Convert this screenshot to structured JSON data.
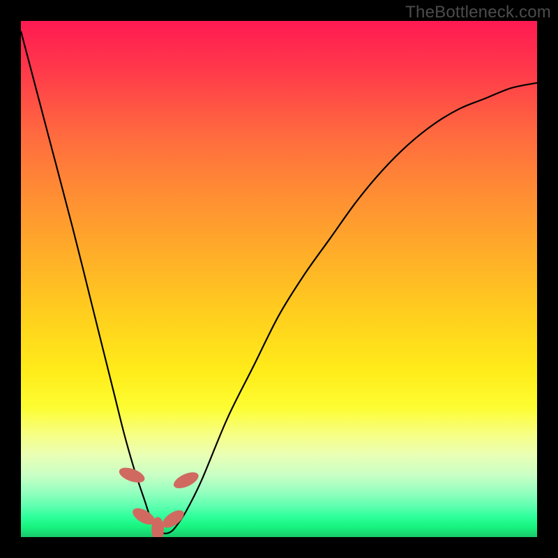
{
  "watermark": "TheBottleneck.com",
  "chart_data": {
    "type": "line",
    "title": "",
    "xlabel": "",
    "ylabel": "",
    "xlim": [
      0,
      100
    ],
    "ylim": [
      0,
      100
    ],
    "series": [
      {
        "name": "curve",
        "x": [
          0,
          5,
          10,
          15,
          18,
          20,
          22,
          24,
          25,
          26,
          27,
          28,
          29,
          30,
          32,
          35,
          40,
          45,
          50,
          55,
          60,
          65,
          70,
          75,
          80,
          85,
          90,
          95,
          100
        ],
        "values": [
          98,
          79,
          60,
          40,
          28,
          20,
          13,
          7,
          4,
          2,
          1,
          0.7,
          1,
          2,
          5,
          11,
          23,
          33,
          43,
          51,
          58,
          65,
          71,
          76,
          80,
          83,
          85,
          87,
          88
        ]
      }
    ],
    "markers": [
      {
        "x": 21.5,
        "y": 12.0,
        "rx": 1.2,
        "ry": 2.6,
        "rot": -70
      },
      {
        "x": 23.8,
        "y": 4.0,
        "rx": 1.2,
        "ry": 2.4,
        "rot": -60
      },
      {
        "x": 26.5,
        "y": 1.5,
        "rx": 1.2,
        "ry": 2.4,
        "rot": 0
      },
      {
        "x": 29.5,
        "y": 3.5,
        "rx": 1.2,
        "ry": 2.4,
        "rot": 55
      },
      {
        "x": 32.0,
        "y": 11.0,
        "rx": 1.2,
        "ry": 2.6,
        "rot": 65
      }
    ],
    "marker_color": "#d06a60",
    "curve_color": "#000000",
    "curve_width": 2.2
  }
}
